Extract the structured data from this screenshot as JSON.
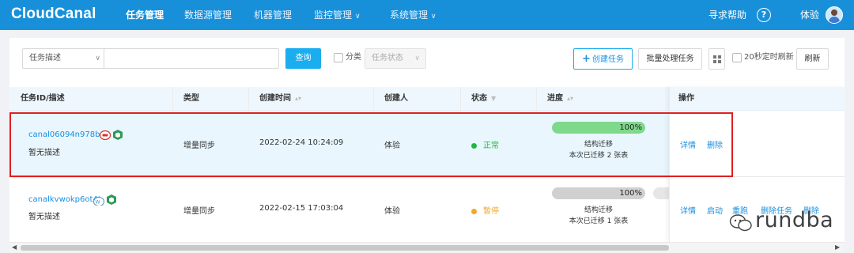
{
  "header": {
    "logo": "CloudCanal",
    "nav": [
      {
        "label": "任务管理",
        "active": true
      },
      {
        "label": "数据源管理"
      },
      {
        "label": "机器管理"
      },
      {
        "label": "监控管理"
      },
      {
        "label": "系统管理"
      }
    ],
    "help": "寻求帮助",
    "help_icon": "?",
    "user": "体验"
  },
  "filters": {
    "search_field": "任务描述",
    "search_value": "",
    "query_button": "查询",
    "category_label": "分类",
    "status_placeholder": "任务状态",
    "create_button": "创建任务",
    "batch_button": "批量处理任务",
    "auto_refresh_label": "20秒定时刷新",
    "refresh_button": "刷新"
  },
  "table": {
    "columns": [
      "任务ID/描述",
      "类型",
      "创建时间",
      "创建人",
      "状态",
      "进度",
      "操作"
    ],
    "rows": [
      {
        "task_id": "canal06094n978bo",
        "description": "暂无描述",
        "type": "增量同步",
        "created_at": "2022-02-24 10:24:09",
        "creator": "体验",
        "status": "正常",
        "status_color": "#1fb83f",
        "progress": 100,
        "progress_label": "100%",
        "progress_color": "#7ed98a",
        "progress_stage": "结构迁移",
        "progress_detail": "本次已迁移 2 张表",
        "actions": [
          "详情",
          "删除"
        ]
      },
      {
        "task_id": "canalkvwokp6ot4t",
        "description": "暂无描述",
        "type": "增量同步",
        "created_at": "2022-02-15 17:03:04",
        "creator": "体验",
        "status": "暂停",
        "status_color": "#f5a623",
        "progress": 100,
        "progress_label": "100%",
        "progress_color": "#d0d0d0",
        "progress_stage": "结构迁移",
        "progress_detail": "本次已迁移 1 张表",
        "actions": [
          "详情",
          "启动",
          "重跑",
          "删除任务",
          "删除"
        ]
      }
    ]
  },
  "watermark": "rundba",
  "colors": {
    "header_bg": "#1890d9",
    "accent": "#1aaef0",
    "highlight_border": "#e02020"
  }
}
